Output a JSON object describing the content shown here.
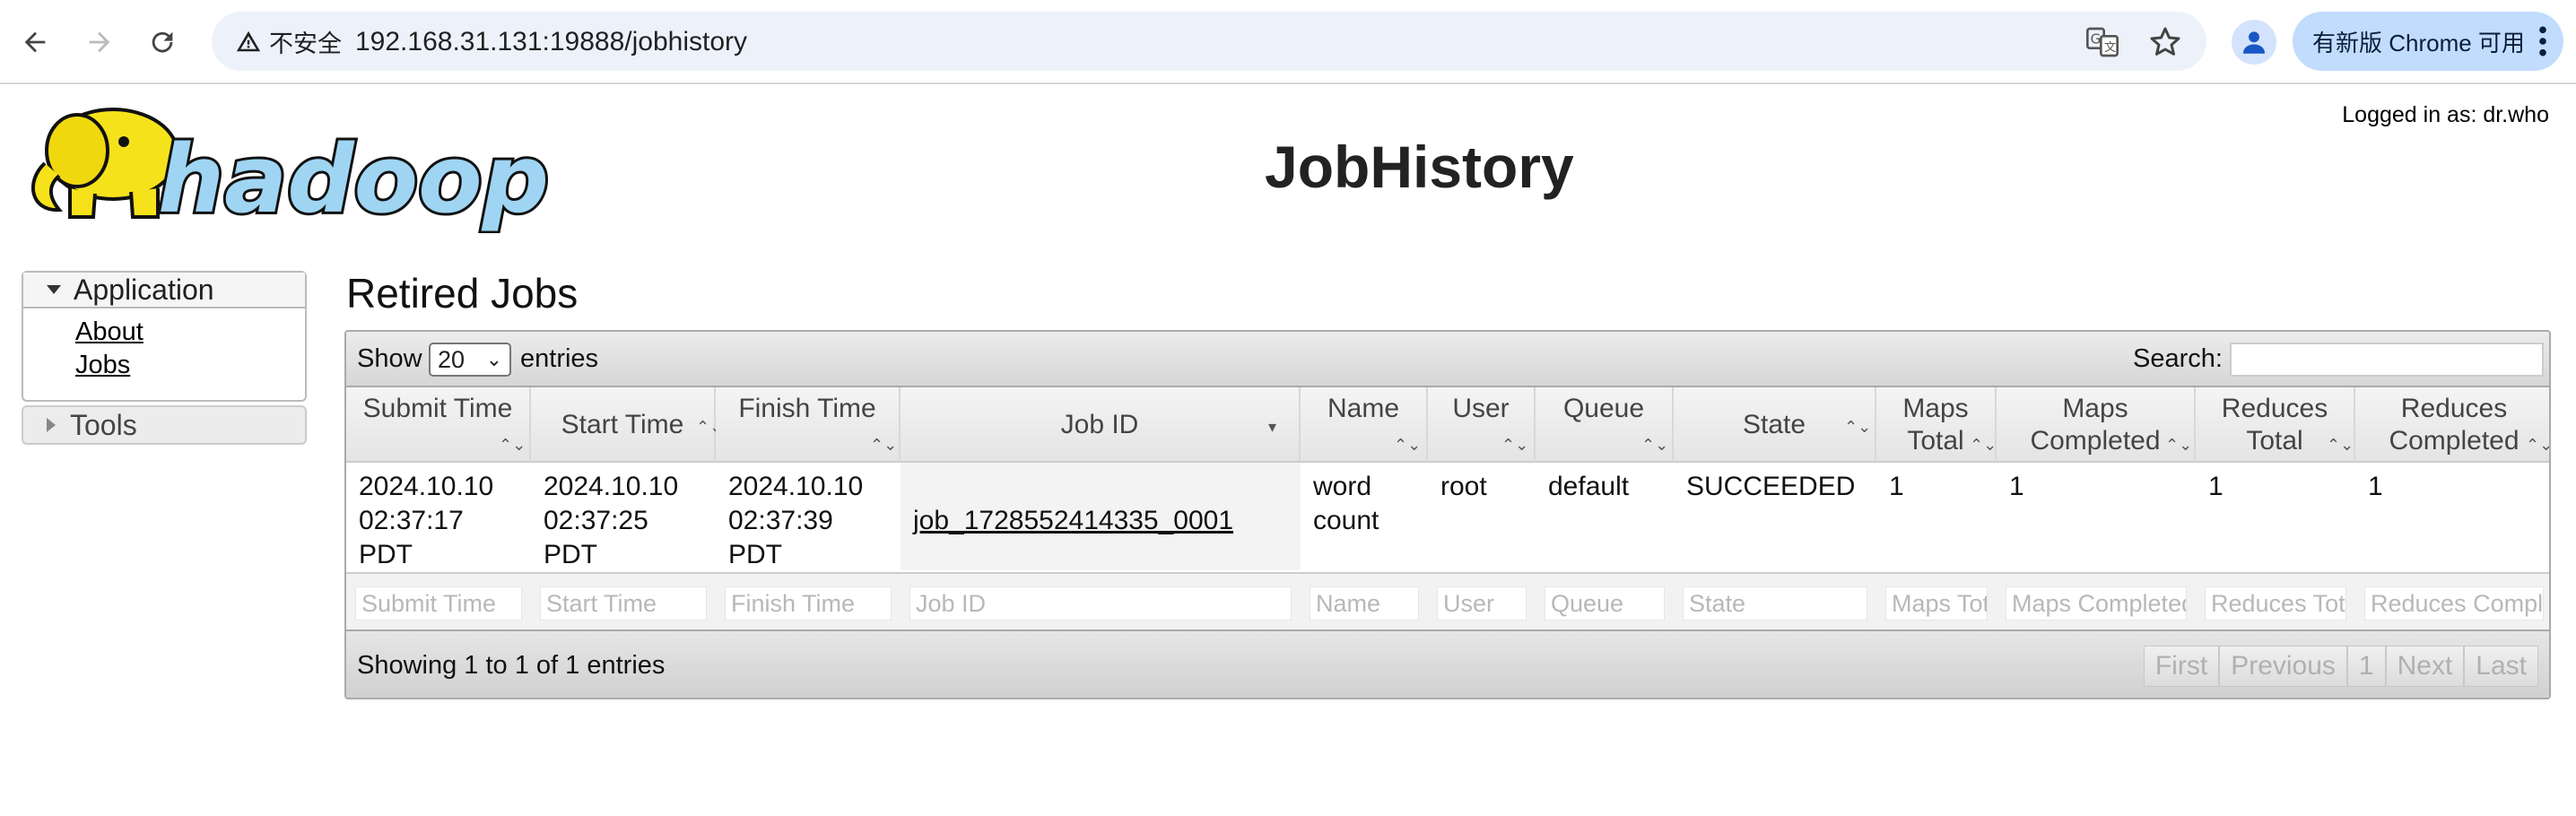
{
  "browser": {
    "security_label": "不安全",
    "url": "192.168.31.131:19888/jobhistory",
    "update_label": "有新版 Chrome 可用"
  },
  "page": {
    "logo_text": "hadoop",
    "title": "JobHistory",
    "logged_in": "Logged in as: dr.who"
  },
  "sidebar": {
    "application": {
      "label": "Application",
      "links": [
        "About",
        "Jobs"
      ]
    },
    "tools": {
      "label": "Tools"
    }
  },
  "section_title": "Retired Jobs",
  "table": {
    "show_label": "Show",
    "entries_value": "20",
    "entries_label": "entries",
    "search_label": "Search:",
    "columns": [
      {
        "label": "Submit Time"
      },
      {
        "label": "Start Time"
      },
      {
        "label": "Finish Time"
      },
      {
        "label": "Job ID"
      },
      {
        "label": "Name"
      },
      {
        "label": "User"
      },
      {
        "label": "Queue"
      },
      {
        "label": "State"
      },
      {
        "label": "Maps Total"
      },
      {
        "label": "Maps Completed"
      },
      {
        "label": "Reduces Total"
      },
      {
        "label": "Reduces Completed"
      }
    ],
    "rows": [
      {
        "submit_time": "2024.10.10\n02:37:17\nPDT",
        "start_time": "2024.10.10\n02:37:25\nPDT",
        "finish_time": "2024.10.10\n02:37:39\nPDT",
        "job_id": "job_1728552414335_0001",
        "name": "word\ncount",
        "user": "root",
        "queue": "default",
        "state": "SUCCEEDED",
        "maps_total": "1",
        "maps_completed": "1",
        "reduces_total": "1",
        "reduces_completed": "1"
      }
    ],
    "filters": [
      "Submit Time",
      "Start Time",
      "Finish Time",
      "Job ID",
      "Name",
      "User",
      "Queue",
      "State",
      "Maps Total",
      "Maps Completed",
      "Reduces Total",
      "Reduces Completed"
    ],
    "footer_info": "Showing 1 to 1 of 1 entries",
    "pager": {
      "first": "First",
      "previous": "Previous",
      "current": "1",
      "next": "Next",
      "last": "Last"
    }
  }
}
